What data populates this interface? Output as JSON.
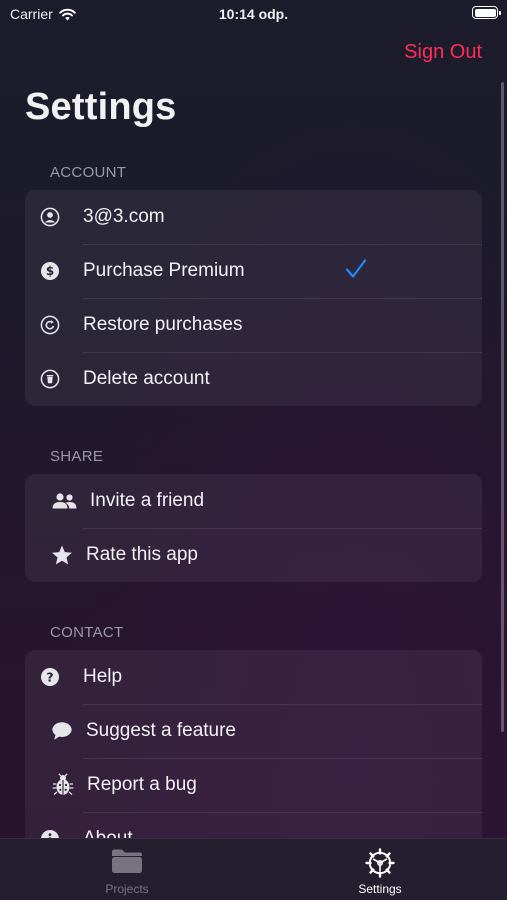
{
  "status_bar": {
    "carrier": "Carrier",
    "time": "10:14 odp."
  },
  "header": {
    "sign_out": "Sign Out",
    "title": "Settings"
  },
  "sections": {
    "account": {
      "header": "ACCOUNT",
      "items": [
        {
          "label": "3@3.com",
          "icon": "person-circle-icon"
        },
        {
          "label": "Purchase Premium",
          "icon": "dollar-circle-icon",
          "checked": true
        },
        {
          "label": "Restore purchases",
          "icon": "restore-circle-icon"
        },
        {
          "label": "Delete account",
          "icon": "trash-circle-icon"
        }
      ]
    },
    "share": {
      "header": "SHARE",
      "items": [
        {
          "label": "Invite a friend",
          "icon": "people-icon"
        },
        {
          "label": "Rate this app",
          "icon": "star-icon"
        }
      ]
    },
    "contact": {
      "header": "CONTACT",
      "items": [
        {
          "label": "Help",
          "icon": "question-circle-icon"
        },
        {
          "label": "Suggest a feature",
          "icon": "speech-bubble-icon"
        },
        {
          "label": "Report a bug",
          "icon": "ladybug-icon"
        },
        {
          "label": "About",
          "icon": "info-circle-icon"
        }
      ]
    }
  },
  "tab_bar": {
    "tabs": [
      {
        "label": "Projects",
        "icon": "folder-icon",
        "selected": false
      },
      {
        "label": "Settings",
        "icon": "gear-icon",
        "selected": true
      }
    ]
  },
  "colors": {
    "accent_red": "#ff2d55",
    "check_blue": "#1e8bff",
    "secondary_text": "#9b98a8",
    "tab_inactive": "#77737f",
    "tab_active": "#ffffff"
  }
}
